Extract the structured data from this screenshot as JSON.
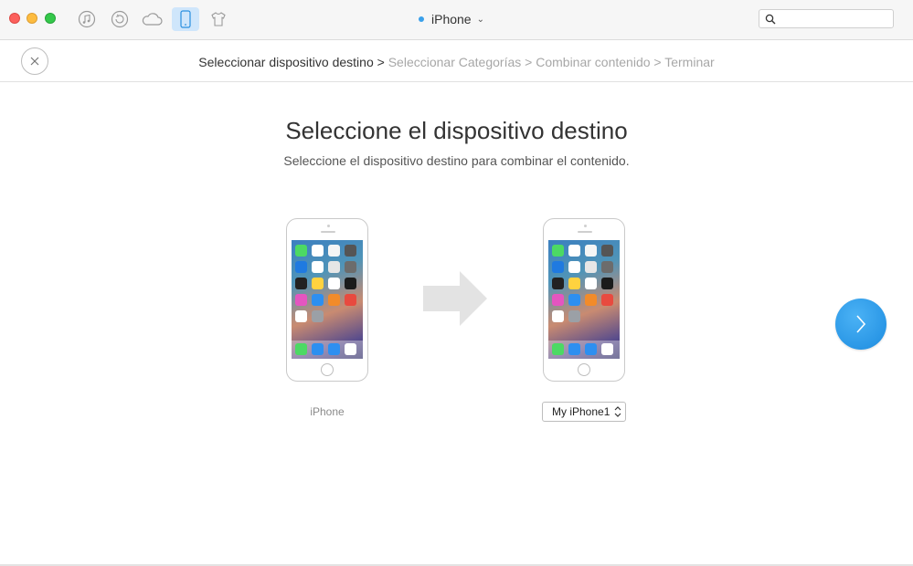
{
  "titlebar": {
    "device_name": "iPhone",
    "search": {
      "value": "",
      "placeholder": ""
    },
    "icons": [
      "itunes-library-icon",
      "backup-restore-icon",
      "icloud-icon",
      "iphone-device-icon",
      "shirt-icon"
    ],
    "active_icon": "iphone-device-icon"
  },
  "breadcrumb": {
    "steps": [
      {
        "label": "Seleccionar dispositivo destino",
        "state": "current"
      },
      {
        "label": "Seleccionar Categorías",
        "state": "pending"
      },
      {
        "label": "Combinar contenido",
        "state": "pending"
      },
      {
        "label": "Terminar",
        "state": "pending"
      }
    ],
    "separator": ">"
  },
  "main": {
    "title": "Seleccione el dispositivo destino",
    "subtitle": "Seleccione el dispositivo destino para combinar el contenido.",
    "source_device": {
      "label": "iPhone"
    },
    "target_device": {
      "selected": "My iPhone1"
    }
  },
  "colors": {
    "accent": "#2a97e6",
    "current_step_text": "#333333",
    "pending_step_text": "#a7a7a7"
  }
}
